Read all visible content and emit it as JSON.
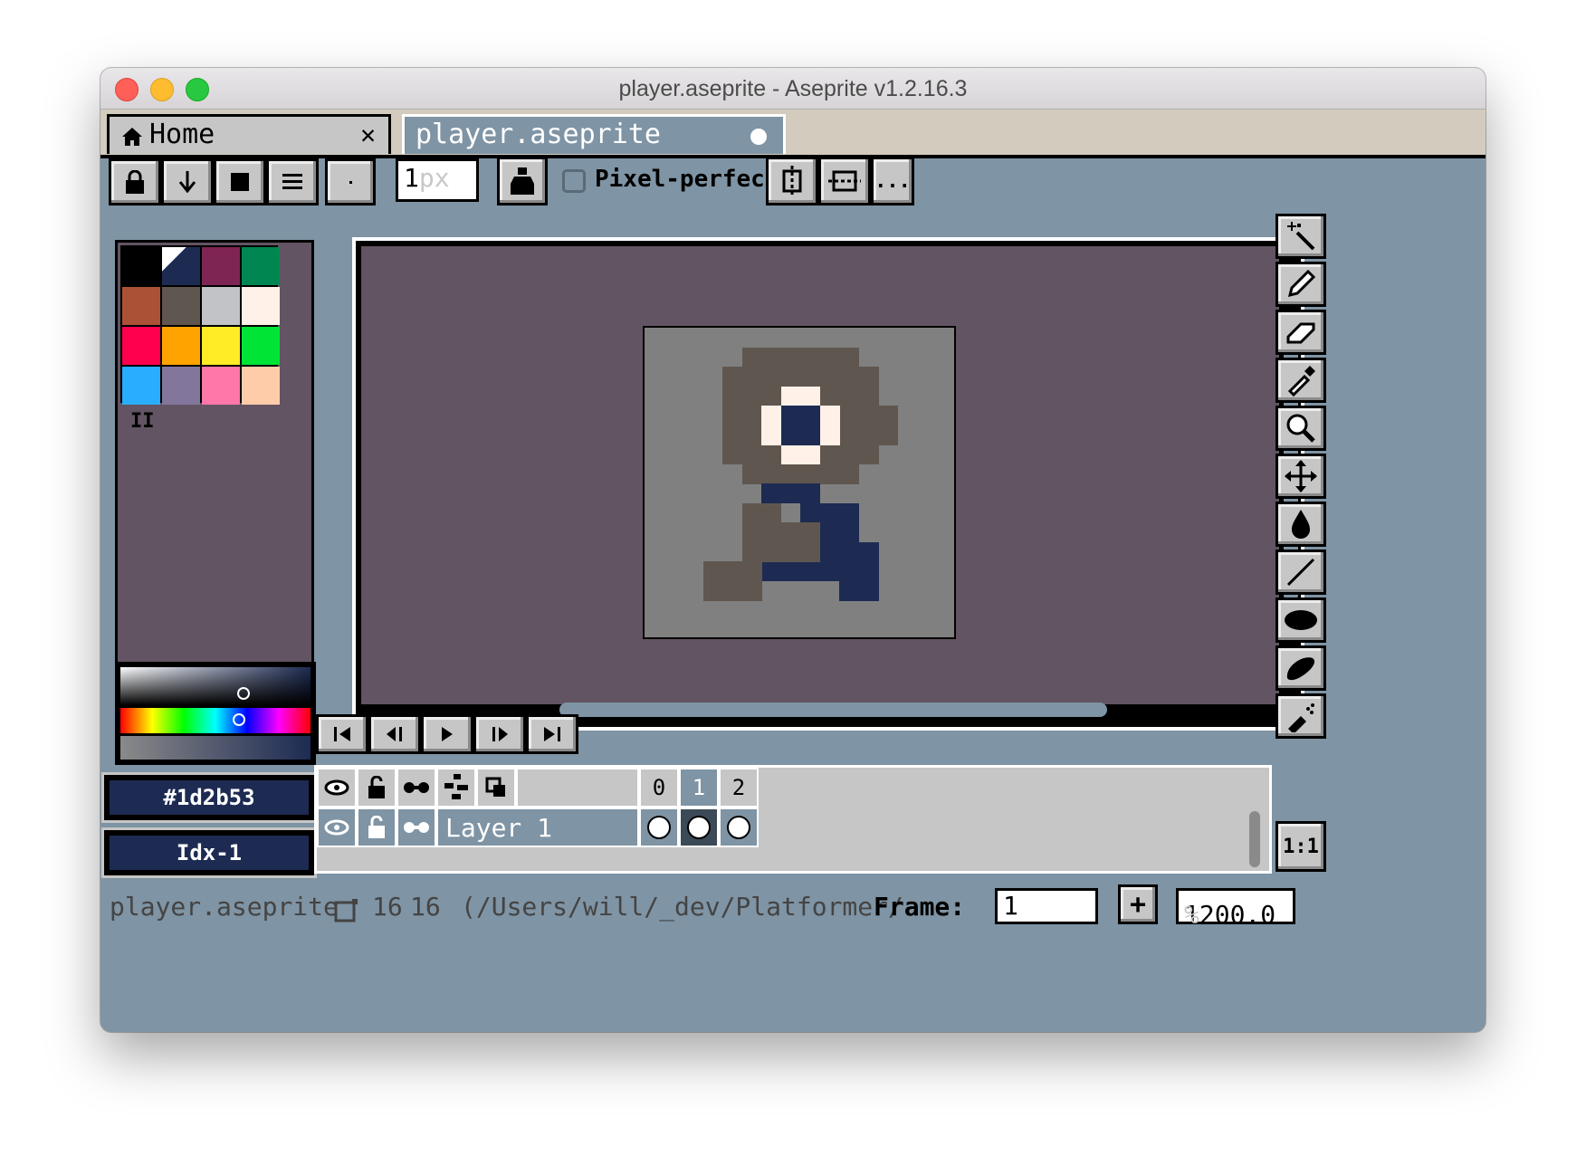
{
  "window": {
    "title": "player.aseprite - Aseprite v1.2.16.3"
  },
  "tabs": [
    {
      "label": "Home"
    },
    {
      "label": "player.aseprite"
    }
  ],
  "toolbar": {
    "brush_size_value": "1",
    "brush_size_unit": "px",
    "pixel_perfect_label": "Pixel-perfect",
    "more_label": "...",
    "pixel_perfect_checked": false
  },
  "palette": {
    "colors": [
      "#000000",
      "#1d2b53",
      "#7e2553",
      "#008751",
      "#ab5236",
      "#5f574f",
      "#c2c3c7",
      "#fff1e8",
      "#ff004d",
      "#ffa300",
      "#ffec27",
      "#00e436",
      "#29adff",
      "#83769c",
      "#ff77a8",
      "#ffccaa"
    ],
    "page_indicator": "II"
  },
  "color": {
    "hex": "#1d2b53",
    "index": "Idx-1"
  },
  "timeline": {
    "frames": [
      "0",
      "1",
      "2"
    ],
    "active_frame": "1",
    "layers": [
      {
        "name": "Layer 1"
      }
    ]
  },
  "status": {
    "filename": "player.aseprite",
    "width": "16",
    "height": "16",
    "path": "(/Users/will/_dev/Platformer/",
    "frame_label": "Frame:",
    "frame_value": "1",
    "zoom_value": "1200.0",
    "zoom_unit": "%",
    "zoom_reset": "1:1"
  },
  "sprite_colors": {
    "body": "#5f574f",
    "eye_white": "#fff1e8",
    "eye_pupil": "#1d2b53",
    "legs": "#1d2b53",
    "canvas_bg": "#808080"
  }
}
